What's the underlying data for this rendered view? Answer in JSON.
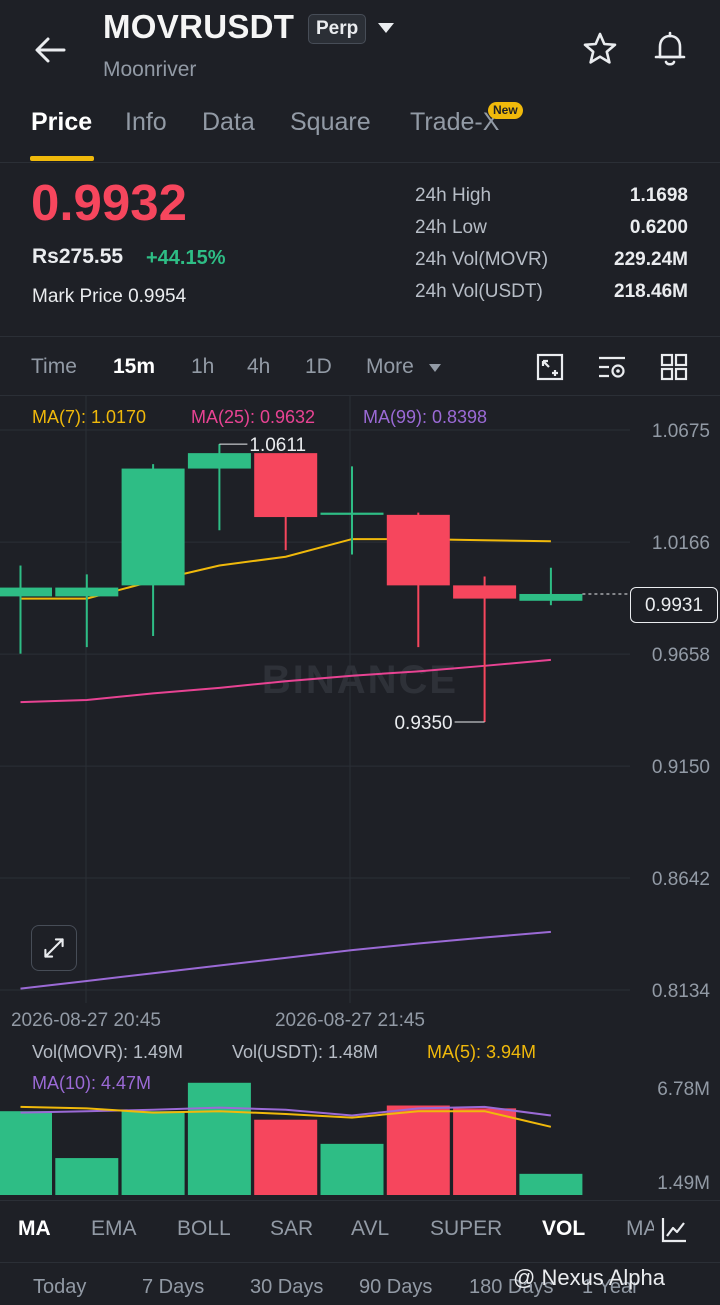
{
  "header": {
    "symbol": "MOVRUSDT",
    "contract_badge": "Perp",
    "subtitle": "Moonriver"
  },
  "tabs": [
    {
      "label": "Price",
      "active": true
    },
    {
      "label": "Info",
      "active": false
    },
    {
      "label": "Data",
      "active": false
    },
    {
      "label": "Square",
      "active": false
    },
    {
      "label": "Trade-X",
      "active": false,
      "badge": "New"
    }
  ],
  "ticker": {
    "last_price": "0.9932",
    "fiat_price": "Rs275.55",
    "change_pct": "+44.15%",
    "mark_price_label": "Mark Price",
    "mark_price": "0.9954",
    "stats": [
      {
        "label": "24h High",
        "value": "1.1698"
      },
      {
        "label": "24h Low",
        "value": "0.6200"
      },
      {
        "label": "24h Vol(MOVR)",
        "value": "229.24M"
      },
      {
        "label": "24h Vol(USDT)",
        "value": "218.46M"
      }
    ]
  },
  "intervals": [
    {
      "label": "Time",
      "active": false
    },
    {
      "label": "15m",
      "active": true
    },
    {
      "label": "1h",
      "active": false
    },
    {
      "label": "4h",
      "active": false
    },
    {
      "label": "1D",
      "active": false
    },
    {
      "label": "More",
      "active": false
    }
  ],
  "ma_legend": [
    {
      "label": "MA(7): 1.0170",
      "color": "#f0b90b"
    },
    {
      "label": "MA(25): 0.9632",
      "color": "#e84393"
    },
    {
      "label": "MA(99): 0.8398",
      "color": "#9b6ad6"
    }
  ],
  "chart_data": {
    "type": "candlestick",
    "y_ticks": [
      "1.0675",
      "1.0166",
      "0.9658",
      "0.9150",
      "0.8642",
      "0.8134"
    ],
    "ylim": [
      0.8134,
      1.0675
    ],
    "x_ticks": [
      "2026-08-27 20:45",
      "2026-08-27 21:45"
    ],
    "current_price_tag": "0.9931",
    "high_annotation": "1.0611",
    "low_annotation": "0.9350",
    "watermark": "BINANCE",
    "candles": [
      {
        "open": 0.992,
        "high": 1.006,
        "low": 0.966,
        "close": 0.996
      },
      {
        "open": 0.992,
        "high": 1.002,
        "low": 0.969,
        "close": 0.996
      },
      {
        "open": 0.997,
        "high": 1.052,
        "low": 0.974,
        "close": 1.05
      },
      {
        "open": 1.05,
        "high": 1.0611,
        "low": 1.022,
        "close": 1.057
      },
      {
        "open": 1.057,
        "high": 1.057,
        "low": 1.013,
        "close": 1.028
      },
      {
        "open": 1.029,
        "high": 1.051,
        "low": 1.011,
        "close": 1.03
      },
      {
        "open": 1.029,
        "high": 1.03,
        "low": 0.969,
        "close": 0.997
      },
      {
        "open": 0.997,
        "high": 1.001,
        "low": 0.935,
        "close": 0.991
      },
      {
        "open": 0.99,
        "high": 1.005,
        "low": 0.988,
        "close": 0.9931
      }
    ],
    "ma7": [
      0.991,
      0.991,
      0.999,
      1.006,
      1.01,
      1.018,
      1.018,
      1.0175,
      1.017
    ],
    "ma25": [
      0.944,
      0.945,
      0.948,
      0.9505,
      0.9535,
      0.956,
      0.958,
      0.9605,
      0.9632
    ],
    "ma99": [
      0.814,
      0.8175,
      0.821,
      0.8245,
      0.828,
      0.8315,
      0.8345,
      0.8372,
      0.8398
    ],
    "volume": {
      "legend": [
        {
          "label": "Vol(MOVR): 1.49M",
          "color": "#b7bdc6"
        },
        {
          "label": "Vol(USDT): 1.48M",
          "color": "#b7bdc6"
        },
        {
          "label": "MA(5): 3.94M",
          "color": "#f0b90b"
        },
        {
          "label": "MA(10): 4.47M",
          "color": "#9b6ad6"
        }
      ],
      "y_ticks": [
        "6.78M",
        "1.49M"
      ],
      "values": [
        5.9,
        2.6,
        5.9,
        7.9,
        5.3,
        3.6,
        6.3,
        6.1,
        1.49
      ],
      "ma5": [
        6.2,
        6.1,
        5.8,
        5.9,
        5.7,
        5.45,
        5.9,
        5.9,
        4.8
      ],
      "ma10": [
        5.8,
        5.9,
        6.0,
        6.15,
        6.0,
        5.6,
        6.1,
        6.2,
        5.6
      ],
      "vmax": 8.8
    }
  },
  "indicators": [
    {
      "label": "MA",
      "active": true
    },
    {
      "label": "EMA",
      "active": false
    },
    {
      "label": "BOLL",
      "active": false
    },
    {
      "label": "SAR",
      "active": false
    },
    {
      "label": "AVL",
      "active": false
    },
    {
      "label": "SUPER",
      "active": false
    },
    {
      "label": "VOL",
      "active": true
    },
    {
      "label": "MA",
      "active": false
    }
  ],
  "ranges": [
    "Today",
    "7 Days",
    "30 Days",
    "90 Days",
    "180 Days",
    "1 Year"
  ],
  "watermark_overlay": "@ Nexus Alpha",
  "colors": {
    "up": "#2ebd85",
    "down": "#f6465d",
    "accent": "#f0b90b",
    "background": "#1e2026"
  }
}
